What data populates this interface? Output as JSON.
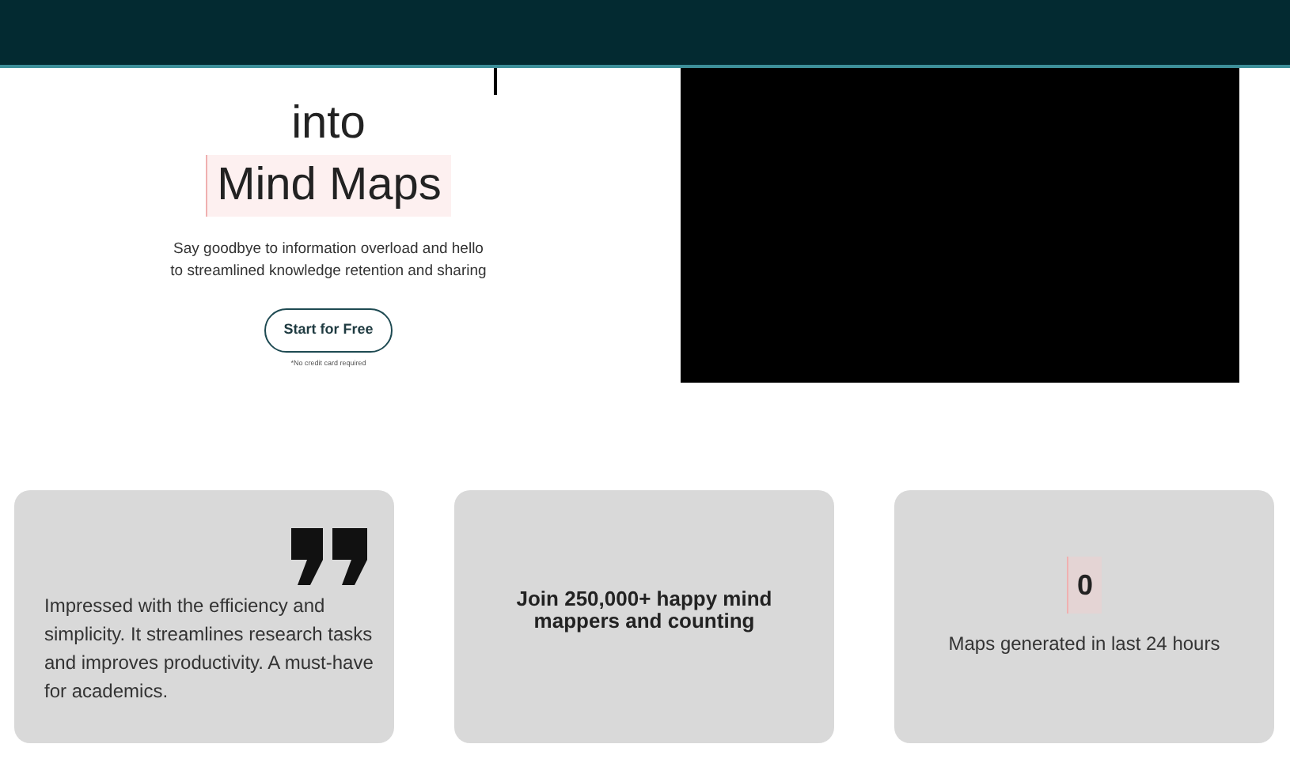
{
  "hero": {
    "heading_lines": [
      {
        "text": "into",
        "highlighted": false
      },
      {
        "text": "Mind Maps",
        "highlighted": true
      }
    ],
    "subtitle": "Say goodbye to information overload and hello to streamlined knowledge retention and sharing",
    "cta": "Start for Free",
    "note": "*No credit card required"
  },
  "cards": [
    {
      "kind": "quote",
      "text": "Impressed with the efficiency and simplicity. It streamlines research tasks and improves productivity. A must-have for academics."
    },
    {
      "kind": "headline",
      "text": "Join 250,000+ happy mind mappers and counting"
    },
    {
      "kind": "stat",
      "value": "0",
      "text": "Maps generated in last 24 hours"
    }
  ]
}
